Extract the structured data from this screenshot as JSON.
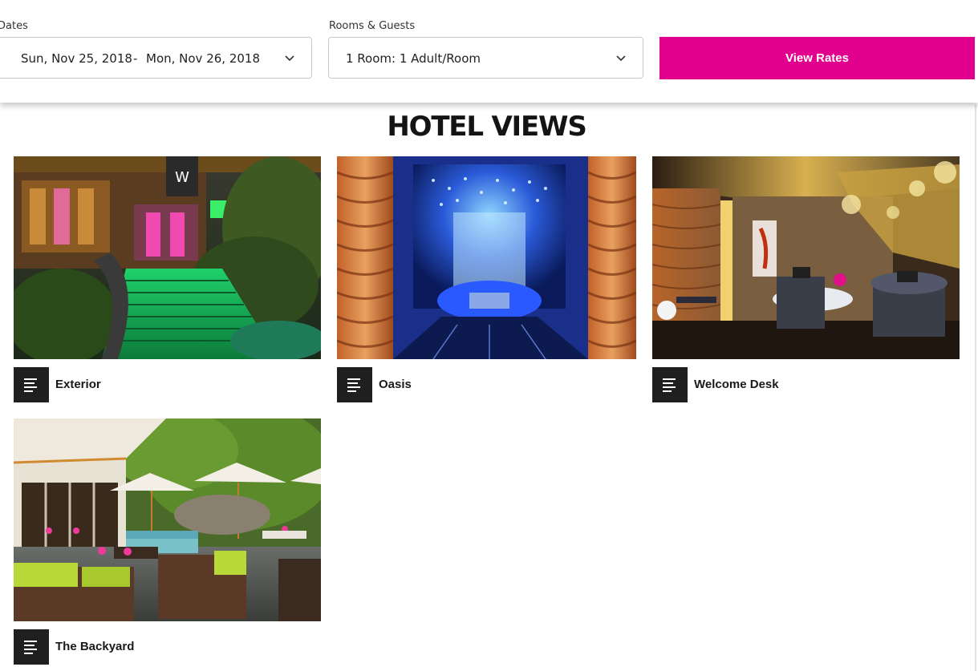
{
  "booking": {
    "dates_label": "Dates",
    "check_in": "Sun, Nov 25, 2018",
    "date_separator": "-",
    "check_out": "Mon, Nov 26, 2018",
    "rooms_label": "Rooms & Guests",
    "rooms_value": "1 Room: 1 Adult/Room",
    "cta_label": "View Rates",
    "cta_color": "#e1008e"
  },
  "section": {
    "title": "HOTEL VIEWS"
  },
  "gallery": [
    {
      "caption": "Exterior",
      "icon": "text-lines-icon"
    },
    {
      "caption": "Oasis",
      "icon": "text-lines-icon"
    },
    {
      "caption": "Welcome Desk",
      "icon": "text-lines-icon"
    },
    {
      "caption": "The Backyard",
      "icon": "text-lines-icon"
    }
  ]
}
